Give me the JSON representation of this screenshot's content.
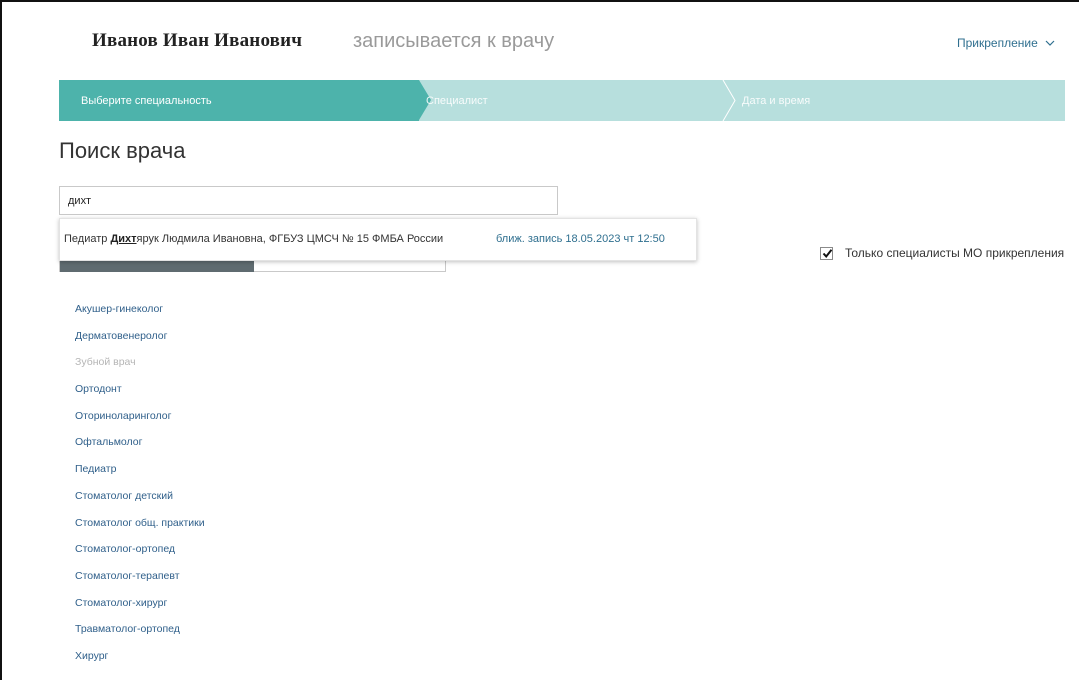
{
  "header": {
    "patient_name": "Иванов Иван Иванович",
    "subtitle": "записывается к врачу",
    "attach_link": "Прикрепление"
  },
  "stepper": {
    "steps": [
      {
        "label": "Выберите специальность",
        "active": true
      },
      {
        "label": "Специалист",
        "active": false
      },
      {
        "label": "Дата и время",
        "active": false
      }
    ]
  },
  "page_title": "Поиск врача",
  "search": {
    "value": "дихт",
    "placeholder": ""
  },
  "suggestion": {
    "prefix": "Педиатр ",
    "match": "Дихт",
    "rest": "ярук Людмила Ивановна, ФГБУЗ ЦМСЧ № 15 ФМБА России",
    "nearest": "ближ. запись 18.05.2023 чт 12:50"
  },
  "filter": {
    "label": "Только специалисты МО прикрепления",
    "checked": true
  },
  "specialties": [
    {
      "label": "Акушер-гинеколог",
      "enabled": true
    },
    {
      "label": "Дерматовенеролог",
      "enabled": true
    },
    {
      "label": "Зубной врач",
      "enabled": false
    },
    {
      "label": "Ортодонт",
      "enabled": true
    },
    {
      "label": "Оториноларинголог",
      "enabled": true
    },
    {
      "label": "Офтальмолог",
      "enabled": true
    },
    {
      "label": "Педиатр",
      "enabled": true
    },
    {
      "label": "Стоматолог детский",
      "enabled": true
    },
    {
      "label": "Стоматолог общ. практики",
      "enabled": true
    },
    {
      "label": "Стоматолог-ортопед",
      "enabled": true
    },
    {
      "label": "Стоматолог-терапевт",
      "enabled": true
    },
    {
      "label": "Стоматолог-хирург",
      "enabled": true
    },
    {
      "label": "Травматолог-ортопед",
      "enabled": true
    },
    {
      "label": "Хирург",
      "enabled": true
    }
  ],
  "colors": {
    "accent": "#4db3ab",
    "accent_light": "#b7dfdd",
    "link": "#2f5f8a",
    "disabled": "#b5b5b5"
  }
}
